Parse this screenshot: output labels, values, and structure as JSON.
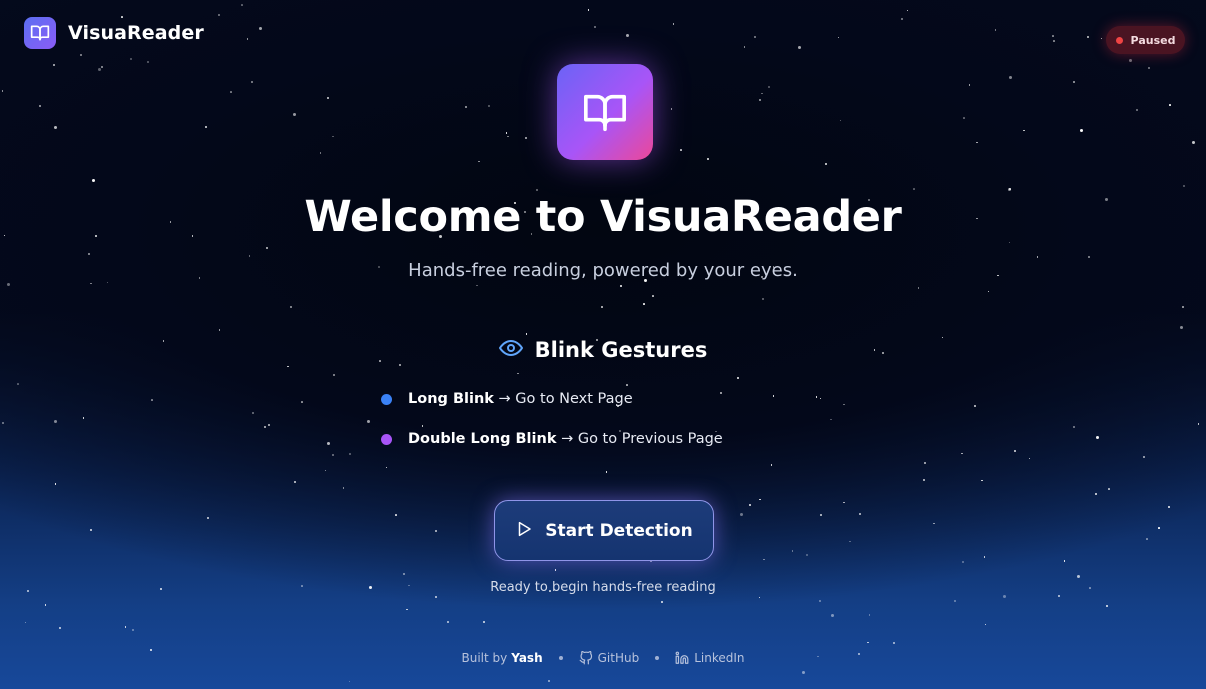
{
  "brand": {
    "name": "VisuaReader",
    "icon": "book-open-icon"
  },
  "status": {
    "label": "Paused",
    "color": "#ef4444"
  },
  "hero": {
    "icon": "book-open-icon",
    "title": "Welcome to VisuaReader",
    "subtitle": "Hands-free reading, powered by your eyes."
  },
  "gestures": {
    "title": "Blink Gestures",
    "icon": "eye-icon",
    "items": [
      {
        "name": "Long Blink",
        "action": " → Go to Next Page",
        "color": "#3b82f6"
      },
      {
        "name": "Double Long Blink",
        "action": " → Go to Previous Page",
        "color": "#a855f7"
      }
    ]
  },
  "start": {
    "label": "Start Detection",
    "icon": "play-icon",
    "hint": "Ready to begin hands-free reading"
  },
  "footer": {
    "built_by": "Built by",
    "author": "Yash",
    "github": "GitHub",
    "linkedin": "LinkedIn"
  },
  "colors": {
    "accent_purple": "#a855f7",
    "accent_pink": "#ec4899",
    "accent_blue": "#3b82f6",
    "background_top": "#050a1c",
    "background_bottom": "#17489a"
  }
}
